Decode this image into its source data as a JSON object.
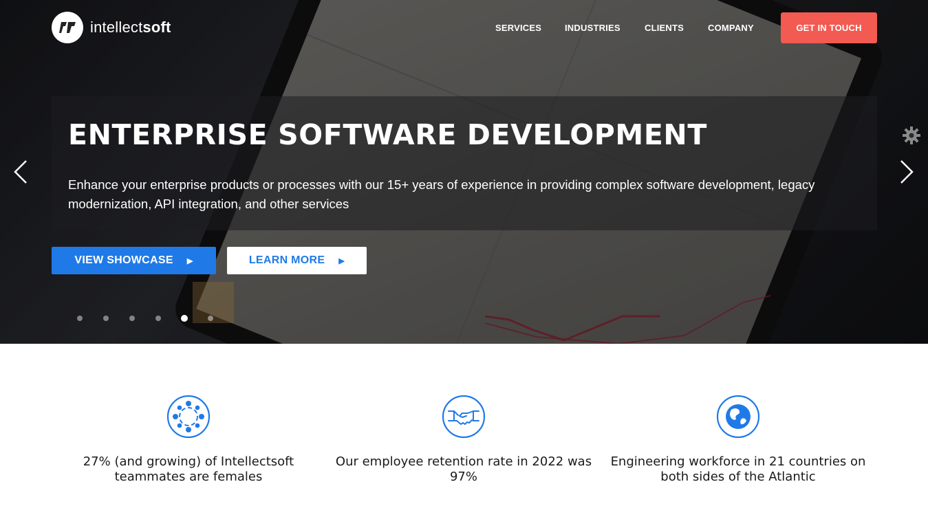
{
  "header": {
    "logo_text_light": "intellect",
    "logo_text_bold": "soft",
    "nav": [
      {
        "label": "SERVICES"
      },
      {
        "label": "INDUSTRIES"
      },
      {
        "label": "CLIENTS"
      },
      {
        "label": "COMPANY"
      }
    ],
    "cta_label": "GET IN TOUCH"
  },
  "hero": {
    "title": "ENTERPRISE SOFTWARE DEVELOPMENT",
    "subtitle": "Enhance your enterprise products or processes with our 15+ years of experience in providing complex software development, legacy modernization, API integration, and other services",
    "primary_button": "VIEW SHOWCASE",
    "secondary_button": "LEARN MORE",
    "slides_total": 6,
    "active_slide": 5
  },
  "stats": [
    {
      "icon": "team-circle-icon",
      "text": "27% (and growing) of Intellectsoft teammates are females"
    },
    {
      "icon": "handshake-icon",
      "text": "Our employee retention rate in 2022 was 97%"
    },
    {
      "icon": "globe-icon",
      "text": "Engineering workforce in 21 countries on both sides of the Atlantic"
    }
  ],
  "colors": {
    "accent_blue": "#1f7ae8",
    "cta_red": "#f25a52",
    "icon_blue": "#1f7ae8"
  }
}
